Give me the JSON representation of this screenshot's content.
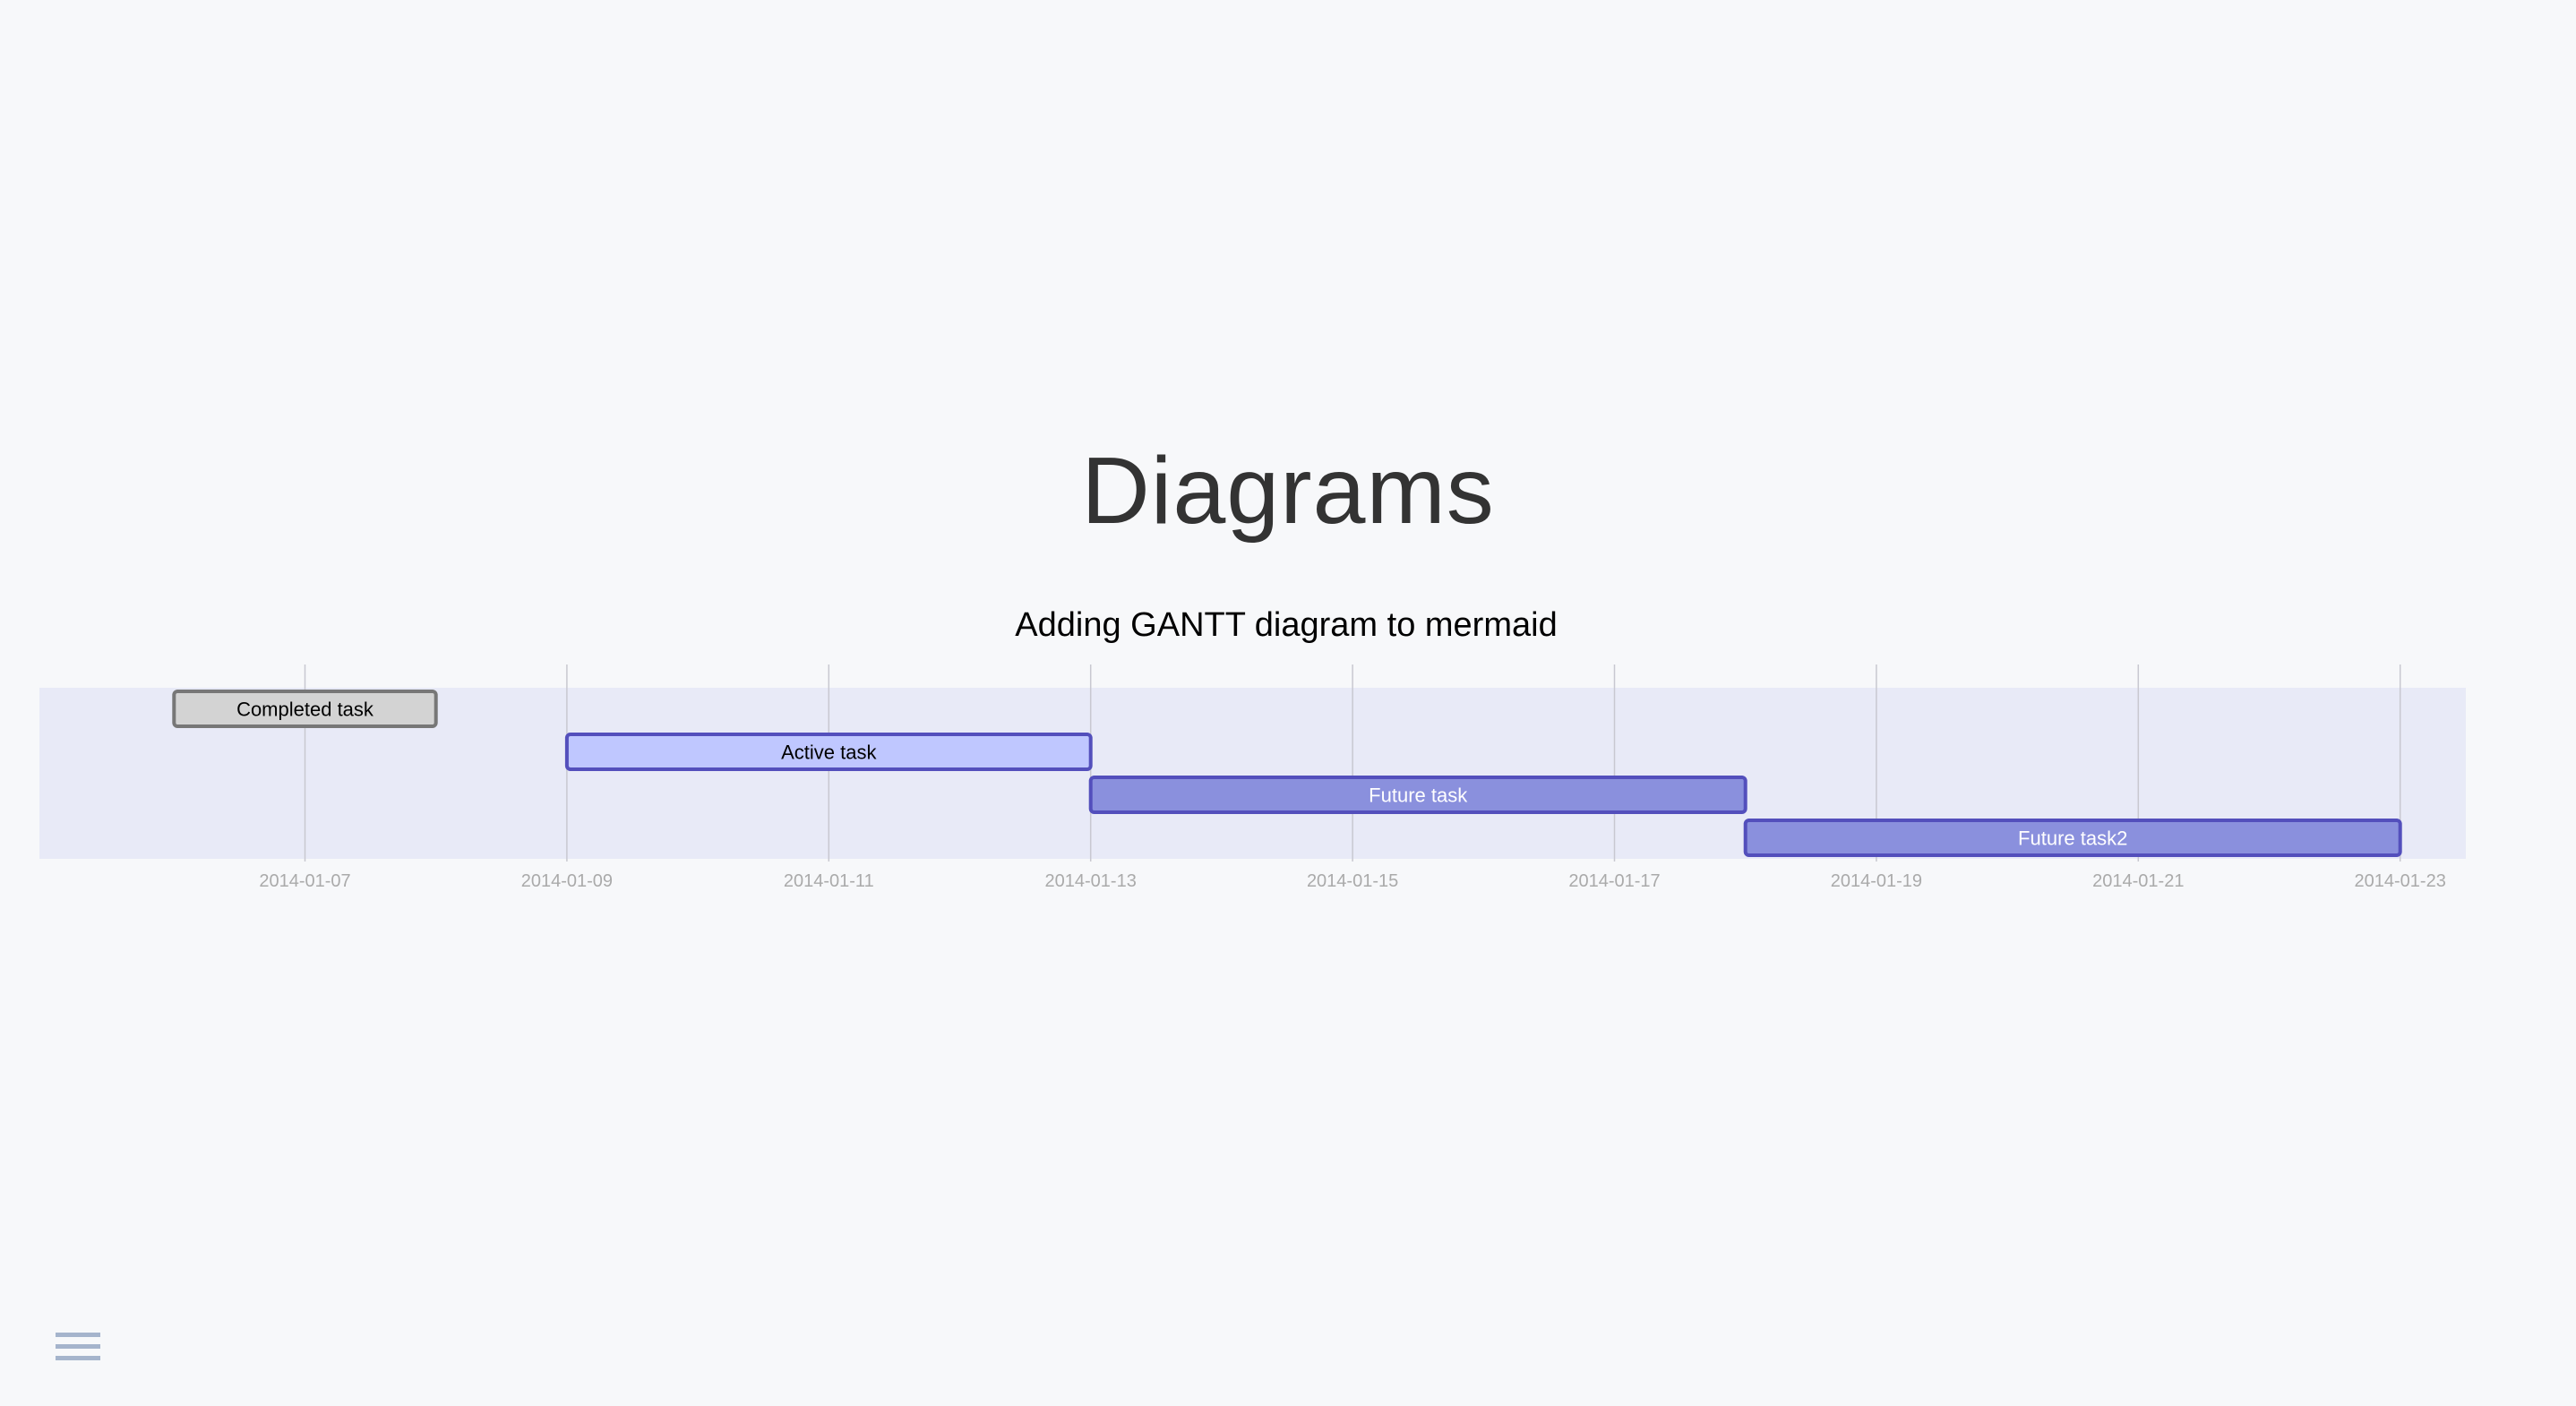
{
  "slide": {
    "title": "Diagrams"
  },
  "chart_data": {
    "type": "gantt",
    "title": "Adding GANTT diagram to mermaid",
    "x_range": [
      "2014-01-05",
      "2014-01-23"
    ],
    "tick_labels": [
      "2014-01-07",
      "2014-01-09",
      "2014-01-11",
      "2014-01-13",
      "2014-01-15",
      "2014-01-17",
      "2014-01-19",
      "2014-01-21",
      "2014-01-23"
    ],
    "tasks": [
      {
        "label": "Completed task",
        "start": "2014-01-06",
        "end": "2014-01-08",
        "status": "done"
      },
      {
        "label": "Active task",
        "start": "2014-01-09",
        "end": "2014-01-13",
        "status": "active"
      },
      {
        "label": "Future task",
        "start": "2014-01-13",
        "end": "2014-01-18",
        "status": "future"
      },
      {
        "label": "Future task2",
        "start": "2014-01-18",
        "end": "2014-01-23",
        "status": "future"
      }
    ],
    "colors": {
      "section_background": "#e8eaf7",
      "grid_line": "#c8c8d0",
      "tick_text": "#aaaaaa",
      "done_fill": "#d3d3d3",
      "done_stroke": "#777777",
      "done_text": "#000000",
      "active_fill": "#bfc7ff",
      "active_stroke": "#534fbc",
      "active_text": "#000000",
      "future_fill": "#8a90dd",
      "future_stroke": "#534fbc",
      "future_text": "#ffffff",
      "title_text": "#000000"
    }
  },
  "controls": {
    "menu_icon": "hamburger-menu-icon",
    "menu_color": "#a5b4cc"
  }
}
